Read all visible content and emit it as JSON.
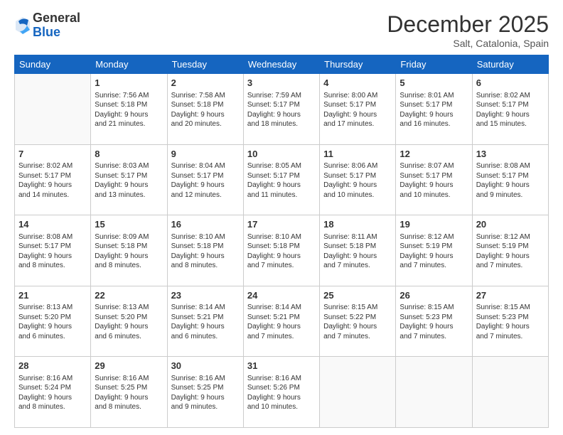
{
  "logo": {
    "general": "General",
    "blue": "Blue"
  },
  "title": "December 2025",
  "location": "Salt, Catalonia, Spain",
  "headers": [
    "Sunday",
    "Monday",
    "Tuesday",
    "Wednesday",
    "Thursday",
    "Friday",
    "Saturday"
  ],
  "weeks": [
    [
      {
        "day": "",
        "info": ""
      },
      {
        "day": "1",
        "info": "Sunrise: 7:56 AM\nSunset: 5:18 PM\nDaylight: 9 hours\nand 21 minutes."
      },
      {
        "day": "2",
        "info": "Sunrise: 7:58 AM\nSunset: 5:18 PM\nDaylight: 9 hours\nand 20 minutes."
      },
      {
        "day": "3",
        "info": "Sunrise: 7:59 AM\nSunset: 5:17 PM\nDaylight: 9 hours\nand 18 minutes."
      },
      {
        "day": "4",
        "info": "Sunrise: 8:00 AM\nSunset: 5:17 PM\nDaylight: 9 hours\nand 17 minutes."
      },
      {
        "day": "5",
        "info": "Sunrise: 8:01 AM\nSunset: 5:17 PM\nDaylight: 9 hours\nand 16 minutes."
      },
      {
        "day": "6",
        "info": "Sunrise: 8:02 AM\nSunset: 5:17 PM\nDaylight: 9 hours\nand 15 minutes."
      }
    ],
    [
      {
        "day": "7",
        "info": "Sunrise: 8:02 AM\nSunset: 5:17 PM\nDaylight: 9 hours\nand 14 minutes."
      },
      {
        "day": "8",
        "info": "Sunrise: 8:03 AM\nSunset: 5:17 PM\nDaylight: 9 hours\nand 13 minutes."
      },
      {
        "day": "9",
        "info": "Sunrise: 8:04 AM\nSunset: 5:17 PM\nDaylight: 9 hours\nand 12 minutes."
      },
      {
        "day": "10",
        "info": "Sunrise: 8:05 AM\nSunset: 5:17 PM\nDaylight: 9 hours\nand 11 minutes."
      },
      {
        "day": "11",
        "info": "Sunrise: 8:06 AM\nSunset: 5:17 PM\nDaylight: 9 hours\nand 10 minutes."
      },
      {
        "day": "12",
        "info": "Sunrise: 8:07 AM\nSunset: 5:17 PM\nDaylight: 9 hours\nand 10 minutes."
      },
      {
        "day": "13",
        "info": "Sunrise: 8:08 AM\nSunset: 5:17 PM\nDaylight: 9 hours\nand 9 minutes."
      }
    ],
    [
      {
        "day": "14",
        "info": "Sunrise: 8:08 AM\nSunset: 5:17 PM\nDaylight: 9 hours\nand 8 minutes."
      },
      {
        "day": "15",
        "info": "Sunrise: 8:09 AM\nSunset: 5:18 PM\nDaylight: 9 hours\nand 8 minutes."
      },
      {
        "day": "16",
        "info": "Sunrise: 8:10 AM\nSunset: 5:18 PM\nDaylight: 9 hours\nand 8 minutes."
      },
      {
        "day": "17",
        "info": "Sunrise: 8:10 AM\nSunset: 5:18 PM\nDaylight: 9 hours\nand 7 minutes."
      },
      {
        "day": "18",
        "info": "Sunrise: 8:11 AM\nSunset: 5:18 PM\nDaylight: 9 hours\nand 7 minutes."
      },
      {
        "day": "19",
        "info": "Sunrise: 8:12 AM\nSunset: 5:19 PM\nDaylight: 9 hours\nand 7 minutes."
      },
      {
        "day": "20",
        "info": "Sunrise: 8:12 AM\nSunset: 5:19 PM\nDaylight: 9 hours\nand 7 minutes."
      }
    ],
    [
      {
        "day": "21",
        "info": "Sunrise: 8:13 AM\nSunset: 5:20 PM\nDaylight: 9 hours\nand 6 minutes."
      },
      {
        "day": "22",
        "info": "Sunrise: 8:13 AM\nSunset: 5:20 PM\nDaylight: 9 hours\nand 6 minutes."
      },
      {
        "day": "23",
        "info": "Sunrise: 8:14 AM\nSunset: 5:21 PM\nDaylight: 9 hours\nand 6 minutes."
      },
      {
        "day": "24",
        "info": "Sunrise: 8:14 AM\nSunset: 5:21 PM\nDaylight: 9 hours\nand 7 minutes."
      },
      {
        "day": "25",
        "info": "Sunrise: 8:15 AM\nSunset: 5:22 PM\nDaylight: 9 hours\nand 7 minutes."
      },
      {
        "day": "26",
        "info": "Sunrise: 8:15 AM\nSunset: 5:23 PM\nDaylight: 9 hours\nand 7 minutes."
      },
      {
        "day": "27",
        "info": "Sunrise: 8:15 AM\nSunset: 5:23 PM\nDaylight: 9 hours\nand 7 minutes."
      }
    ],
    [
      {
        "day": "28",
        "info": "Sunrise: 8:16 AM\nSunset: 5:24 PM\nDaylight: 9 hours\nand 8 minutes."
      },
      {
        "day": "29",
        "info": "Sunrise: 8:16 AM\nSunset: 5:25 PM\nDaylight: 9 hours\nand 8 minutes."
      },
      {
        "day": "30",
        "info": "Sunrise: 8:16 AM\nSunset: 5:25 PM\nDaylight: 9 hours\nand 9 minutes."
      },
      {
        "day": "31",
        "info": "Sunrise: 8:16 AM\nSunset: 5:26 PM\nDaylight: 9 hours\nand 10 minutes."
      },
      {
        "day": "",
        "info": ""
      },
      {
        "day": "",
        "info": ""
      },
      {
        "day": "",
        "info": ""
      }
    ]
  ]
}
